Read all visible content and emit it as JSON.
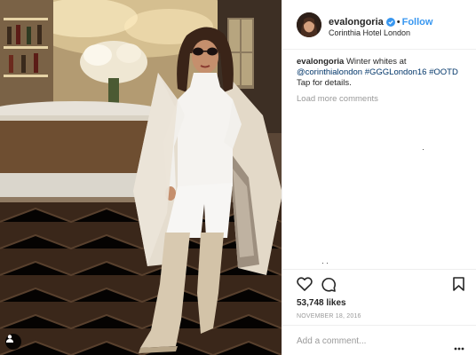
{
  "post": {
    "photo_alt_icon": "user-tag-icon",
    "header": {
      "username": "evalongoria",
      "follow_label": "Follow",
      "location": "Corinthia Hotel London",
      "verified_icon": "verified-badge-icon"
    },
    "caption": {
      "username": "evalongoria",
      "text_before": " Winter whites at ",
      "mention": "@corinthialondon",
      "hashtags": [
        " #GGGLondon16",
        " #OOTD"
      ],
      "text_after": "Tap for details."
    },
    "load_more_label": "Load more comments",
    "likes": "53,748 likes",
    "date": "NOVEMBER 18, 2016",
    "comment_placeholder": "Add a comment...",
    "icons": {
      "like": "heart-icon",
      "comment": "comment-bubble-icon",
      "save": "bookmark-icon",
      "more": "more-options-icon"
    },
    "colors": {
      "link": "#003569",
      "follow": "#3897f0",
      "muted": "#999999"
    }
  }
}
